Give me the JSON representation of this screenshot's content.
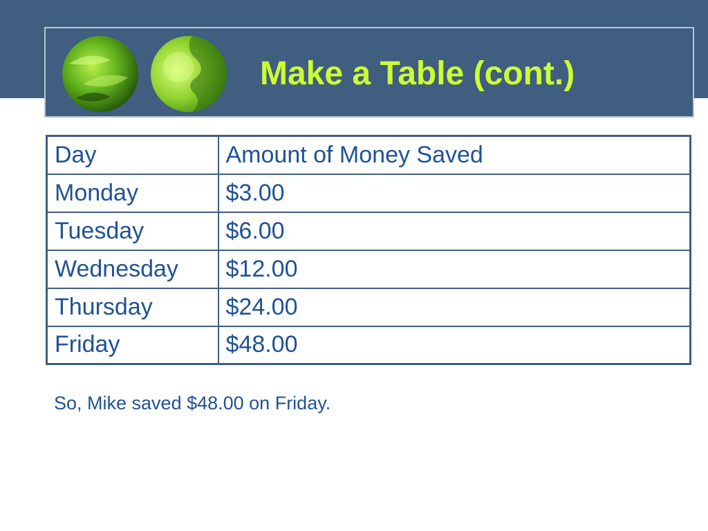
{
  "slide": {
    "title": "Make a Table (cont.)",
    "table": {
      "header": [
        "Day",
        "Amount of Money Saved"
      ],
      "rows": [
        [
          "Monday",
          "$3.00"
        ],
        [
          "Tuesday",
          "$6.00"
        ],
        [
          "Wednesday",
          "$12.00"
        ],
        [
          "Thursday",
          "$24.00"
        ],
        [
          "Friday",
          "$48.00"
        ]
      ]
    },
    "note": "So, Mike saved $48.00 on Friday."
  },
  "colors": {
    "header_background": "#3f5e80",
    "title_color": "#ccff33",
    "text_color": "#1f5294"
  },
  "icons": [
    "green-leaf-image",
    "green-puzzle-image"
  ]
}
